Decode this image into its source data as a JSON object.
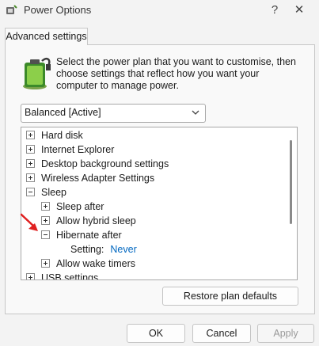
{
  "window": {
    "title": "Power Options",
    "help_glyph": "?",
    "close_glyph": "✕"
  },
  "tabs": [
    {
      "label": "Advanced settings"
    }
  ],
  "description": "Select the power plan that you want to customise, then choose settings that reflect how you want your computer to manage power.",
  "plan_select": {
    "value": "Balanced [Active]"
  },
  "tree": {
    "items": [
      {
        "label": "Hard disk",
        "state": "collapsed"
      },
      {
        "label": "Internet Explorer",
        "state": "collapsed"
      },
      {
        "label": "Desktop background settings",
        "state": "collapsed"
      },
      {
        "label": "Wireless Adapter Settings",
        "state": "collapsed"
      },
      {
        "label": "Sleep",
        "state": "expanded"
      },
      {
        "label": "Sleep after",
        "state": "collapsed"
      },
      {
        "label": "Allow hybrid sleep",
        "state": "collapsed"
      },
      {
        "label": "Hibernate after",
        "state": "expanded"
      },
      {
        "label": "Setting:",
        "value": "Never"
      },
      {
        "label": "Allow wake timers",
        "state": "collapsed"
      },
      {
        "label": "USB settings",
        "state": "collapsed"
      }
    ]
  },
  "buttons": {
    "restore": "Restore plan defaults",
    "ok": "OK",
    "cancel": "Cancel",
    "apply": "Apply"
  },
  "colors": {
    "link": "#0067c0",
    "annotation_arrow": "#e02020"
  }
}
